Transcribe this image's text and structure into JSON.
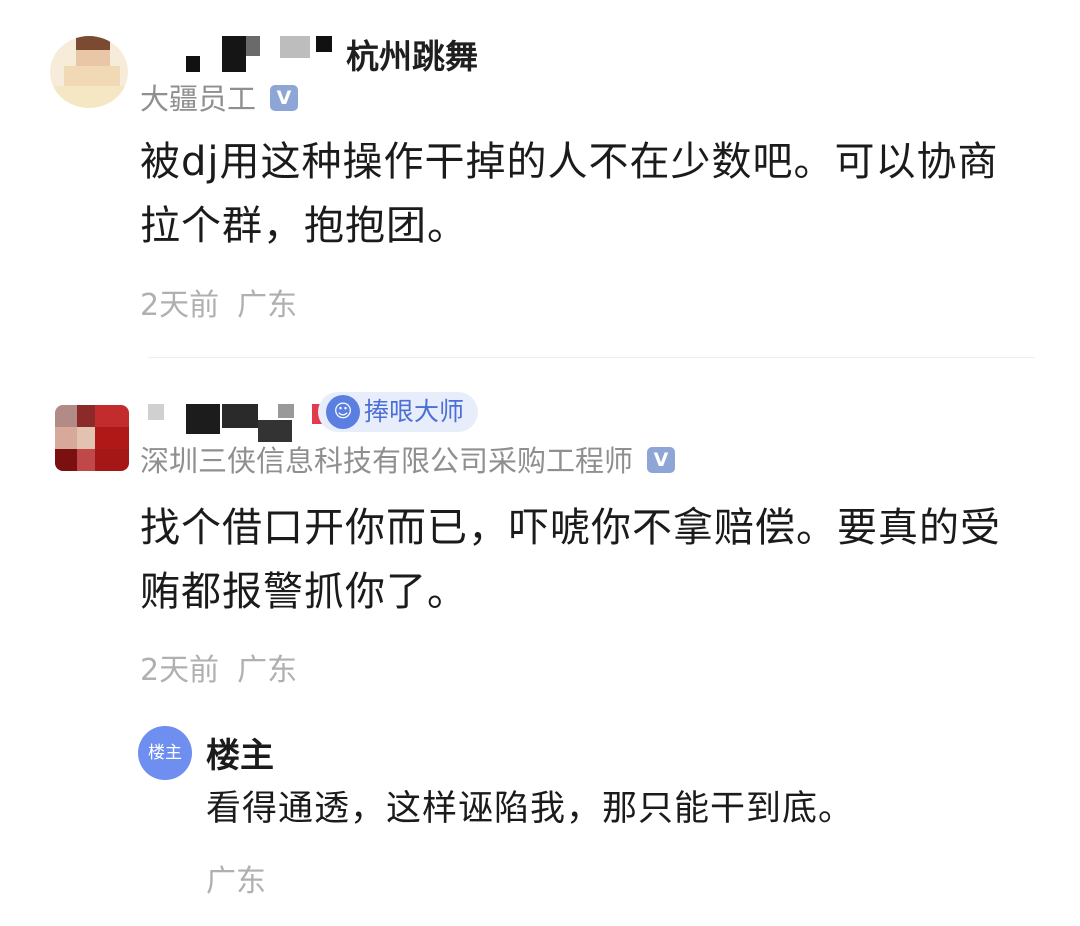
{
  "comments": [
    {
      "user": {
        "name_visible": "杭州跳舞",
        "title": "大疆员工",
        "verified_label": "V"
      },
      "text": "被dj用这种操作干掉的人不在少数吧。可以协商拉个群，抱抱团。",
      "time": "2天前",
      "location": "广东"
    },
    {
      "user": {
        "badge": "捧哏大师",
        "title": "深圳三侠信息科技有限公司采购工程师",
        "verified_label": "V"
      },
      "text": "找个借口开你而已，吓唬你不拿赔偿。要真的受贿都报警抓你了。",
      "time": "2天前",
      "location": "广东"
    }
  ],
  "reply": {
    "avatar_label": "楼主",
    "name": "楼主",
    "text": "看得通透，这样诬陷我，那只能干到底。",
    "location": "广东"
  },
  "colors": {
    "meta_gray": "#b0b0b0",
    "title_gray": "#8f8f8f",
    "verify_badge": "#8ea6d6",
    "reply_avatar": "#6e8ef0",
    "badge_text": "#4a6fd6"
  }
}
